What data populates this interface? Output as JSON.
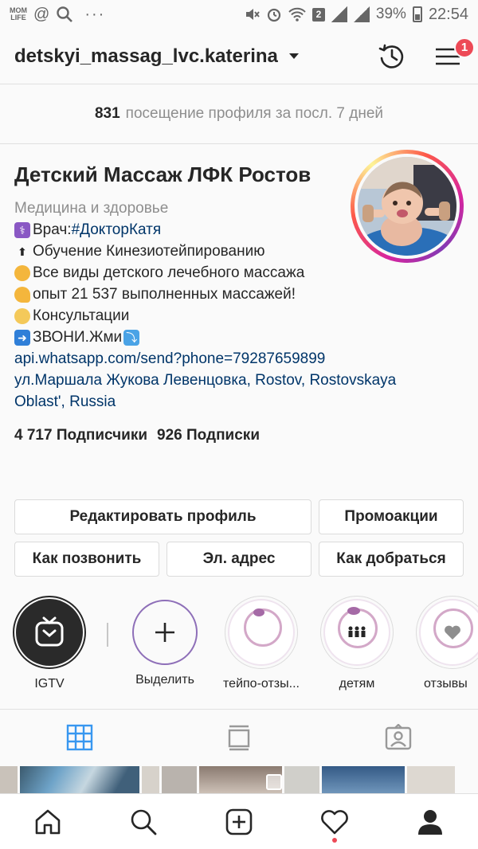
{
  "status_bar": {
    "app_icon": "MOM LIFE",
    "battery": "39%",
    "time": "22:54",
    "sim_badge": "2"
  },
  "header": {
    "username": "detskyi_massag_lvc.katerina",
    "notification_count": "1"
  },
  "visits": {
    "count": "831",
    "text": "посещение профиля за посл. 7 дней"
  },
  "profile": {
    "name": "Детский Массаж ЛФК Ростов",
    "category": "Медицина и здоровье",
    "bio": [
      {
        "icon": "medical-icon",
        "prefix": "Врач:",
        "hashtag": "#ДокторКатя"
      },
      {
        "icon": "top-arrow-icon",
        "text": "Обучение Кинезиотейпированию"
      },
      {
        "icon": "hands-icon",
        "text": "Все виды детского лечебного массажа"
      },
      {
        "icon": "muscle-icon",
        "text": "опыт 21 537 выполненных массажей!"
      },
      {
        "icon": "baby-icon",
        "text": "Консультации"
      },
      {
        "icon": "phone-arrow-icon",
        "text": "ЗВОНИ.Жми",
        "suffix_icon": "down-arrow-icon"
      }
    ],
    "link": "api.whatsapp.com/send?phone=79287659899",
    "address": "ул.Маршала Жукова Левенцовка, Rostov, Rostovskaya Oblast', Russia",
    "followers": "4 717 Подписчики",
    "following": "926 Подписки"
  },
  "buttons": {
    "edit_profile": "Редактировать профиль",
    "promotions": "Промоакции",
    "call": "Как позвонить",
    "email": "Эл. адрес",
    "directions": "Как добраться"
  },
  "highlights": [
    {
      "label": "IGTV"
    },
    {
      "label": "Выделить"
    },
    {
      "label": "тейпо-отзы..."
    },
    {
      "label": "детям"
    },
    {
      "label": "отзывы"
    }
  ],
  "colors": {
    "accent_blue": "#3897f0",
    "link_blue": "#003569",
    "badge_red": "#ed4956"
  }
}
